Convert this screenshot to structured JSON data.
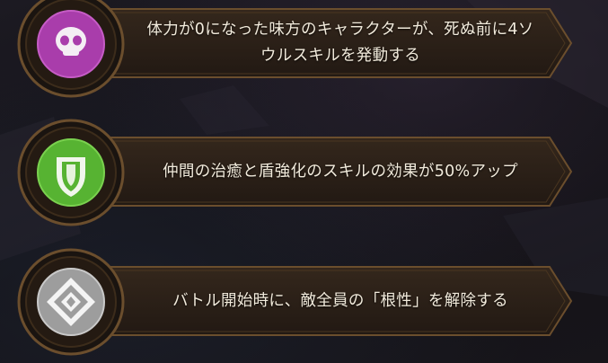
{
  "skills": [
    {
      "icon": "skull-icon",
      "icon_color": "#a93dab",
      "description": "体力が0になった味方のキャラクターが、死ぬ前に4ソウルスキルを発動する"
    },
    {
      "icon": "shield-icon",
      "icon_color": "#57b332",
      "description": "仲間の治癒と盾強化のスキルの効果が50%アップ"
    },
    {
      "icon": "diamond-sigil-icon",
      "icon_color": "#b9b9b9",
      "description": "バトル開始時に、敵全員の「根性」を解除する"
    }
  ],
  "colors": {
    "banner_fill": "#2a1f17",
    "banner_border": "#7a5a34",
    "ring": "#5b4329",
    "text": "#f2ebdc"
  }
}
